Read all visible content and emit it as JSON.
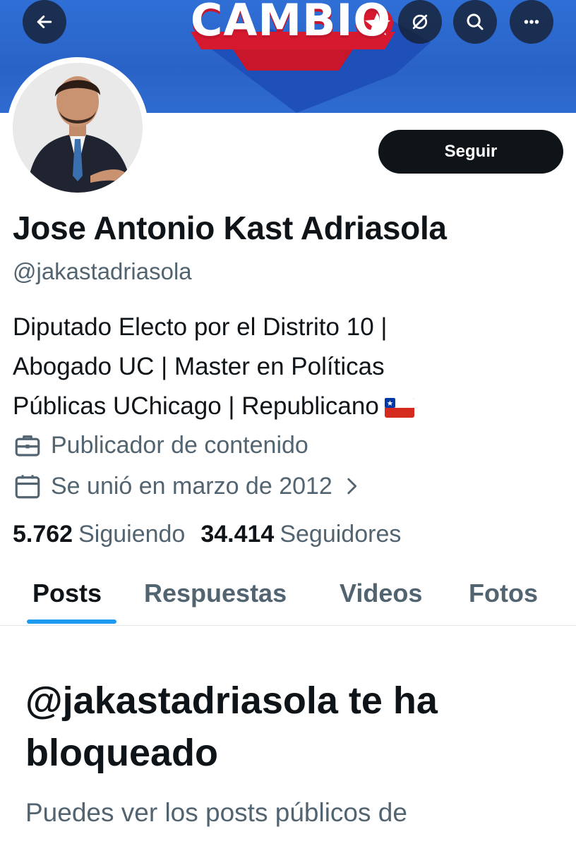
{
  "banner": {
    "text": "CAMBIO",
    "colors": {
      "sky": "#2f6fd6",
      "red": "#d7192f",
      "star": "#1f4fb8"
    }
  },
  "nav": {
    "back_icon": "arrow-left-icon",
    "buttons": [
      {
        "icon": "translate-off-icon"
      },
      {
        "icon": "search-icon"
      },
      {
        "icon": "more-horizontal-icon"
      }
    ]
  },
  "profile": {
    "name": "Jose Antonio Kast Adriasola",
    "handle": "@jakastadriasola",
    "bio_lines": [
      "Diputado Electo por el Distrito 10 |",
      "Abogado UC | Master en Políticas",
      "Públicas UChicago | Republicano"
    ],
    "bio_flag": "chile-flag",
    "category": "Publicador de contenido",
    "joined": "Se unió en marzo de 2012",
    "follow_label": "Seguir"
  },
  "stats": {
    "following_count": "5.762",
    "following_label": "Siguiendo",
    "followers_count": "34.414",
    "followers_label": "Seguidores"
  },
  "tabs": [
    "Posts",
    "Respuestas",
    "Videos",
    "Fotos"
  ],
  "active_tab": "Posts",
  "blocked": {
    "title": "@jakastadriasola te ha bloqueado",
    "text": "Puedes ver los posts públicos de"
  },
  "colors": {
    "accent": "#1d9bf0",
    "text_primary": "#0f1419",
    "text_secondary": "#536471",
    "button_bg": "#0f1419"
  }
}
